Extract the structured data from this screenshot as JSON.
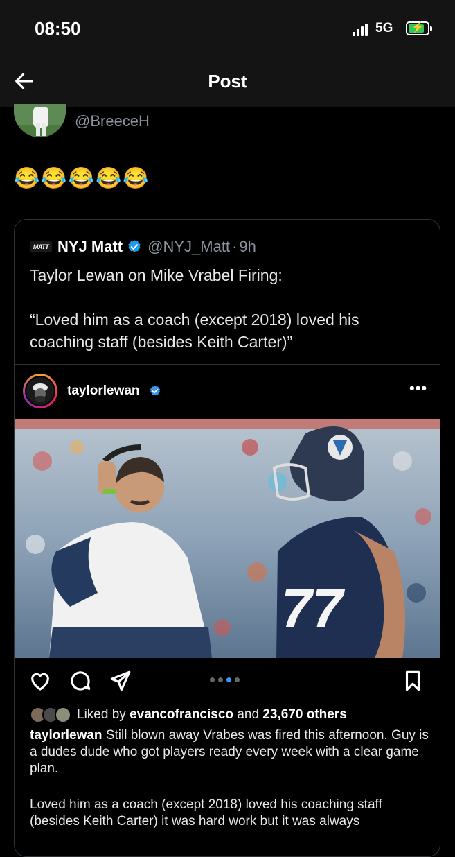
{
  "status_bar": {
    "time": "08:50",
    "network": "5G"
  },
  "header": {
    "title": "Post"
  },
  "author": {
    "handle": "@BreeceH"
  },
  "post": {
    "text": "😂😂😂😂😂"
  },
  "quoted": {
    "name": "NYJ Matt",
    "handle": "@NYJ_Matt",
    "separator": "·",
    "time": "9h",
    "logo_text": "MATT",
    "text": "Taylor Lewan on Mike Vrabel Firing:\n\n“Loved him as a coach (except 2018) loved his coaching staff (besides Keith Carter)”"
  },
  "instagram": {
    "username": "taylorlewan",
    "more": "•••",
    "carousel": {
      "count": 4,
      "active_index": 2
    },
    "likes": {
      "prefix": "Liked by",
      "user": "evancofrancisco",
      "joiner": "and",
      "others": "23,670 others"
    },
    "caption": {
      "user": "taylorlewan",
      "text": "Still blown away Vrabes was fired this afternoon. Guy is a dudes dude who got players ready every week with a clear game plan.",
      "continued": "Loved him as a coach (except 2018) loved his coaching staff (besides Keith Carter) it was hard work but it was always"
    }
  },
  "icons": {
    "back": "arrow-left-icon",
    "verified": "verified-badge-icon",
    "like": "heart-icon",
    "comment": "comment-icon",
    "share": "send-icon",
    "save": "bookmark-icon"
  },
  "colors": {
    "accent": "#1d9bf0",
    "ig_dot_active": "#3897f0",
    "battery": "#34c759"
  }
}
